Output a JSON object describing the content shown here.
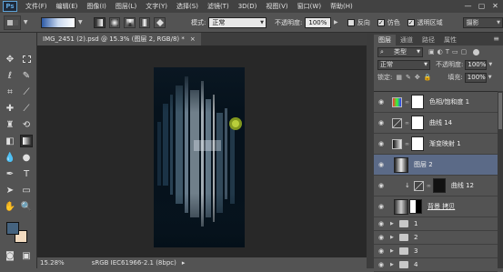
{
  "app": {
    "logo": "Ps"
  },
  "menu": [
    "文件(F)",
    "编辑(E)",
    "图像(I)",
    "图层(L)",
    "文字(Y)",
    "选择(S)",
    "滤镜(T)",
    "3D(D)",
    "视图(V)",
    "窗口(W)",
    "帮助(H)"
  ],
  "window_controls": [
    "—",
    "▢",
    "✕"
  ],
  "options": {
    "mode_label": "模式:",
    "mode_value": "正常",
    "opacity_label": "不透明度:",
    "opacity_value": "100%",
    "reverse_label": "反向",
    "dither_label": "仿色",
    "transparency_label": "透明区域",
    "workspace_value": "摄影"
  },
  "document": {
    "tab_title": "IMG_2451 (2).psd @ 15.3% (图层 2, RGB/8) *",
    "close_glyph": "×"
  },
  "status": {
    "zoom": "15.28%",
    "profile": "sRGB IEC61966-2.1 (8bpc)",
    "arrow": "▸"
  },
  "panel": {
    "tabs": [
      "图层",
      "通道",
      "路径",
      "属性"
    ],
    "menu_glyph": "≡",
    "filter_type": "类型",
    "blend_mode": "正常",
    "opacity_label": "不透明度:",
    "opacity_value": "100%",
    "lock_label": "锁定:",
    "fill_label": "填充:",
    "fill_value": "100%"
  },
  "layers": [
    {
      "name": "色相/饱和度 1",
      "kind": "adjustment"
    },
    {
      "name": "曲线 14",
      "kind": "adjustment"
    },
    {
      "name": "渐变映射 1",
      "kind": "adjustment"
    },
    {
      "name": "图层 2",
      "kind": "pixel",
      "selected": true
    },
    {
      "name": "曲线 12",
      "kind": "clipped"
    },
    {
      "name": "背景 拷贝",
      "kind": "smart"
    },
    {
      "name": "1",
      "kind": "group"
    },
    {
      "name": "2",
      "kind": "group"
    },
    {
      "name": "3",
      "kind": "group"
    },
    {
      "name": "4",
      "kind": "group"
    }
  ],
  "colors": {
    "foreground": "#45637f",
    "background": "#f3dcc1",
    "selected_layer": "#5b6a87",
    "accent": "#5fa3d8"
  }
}
